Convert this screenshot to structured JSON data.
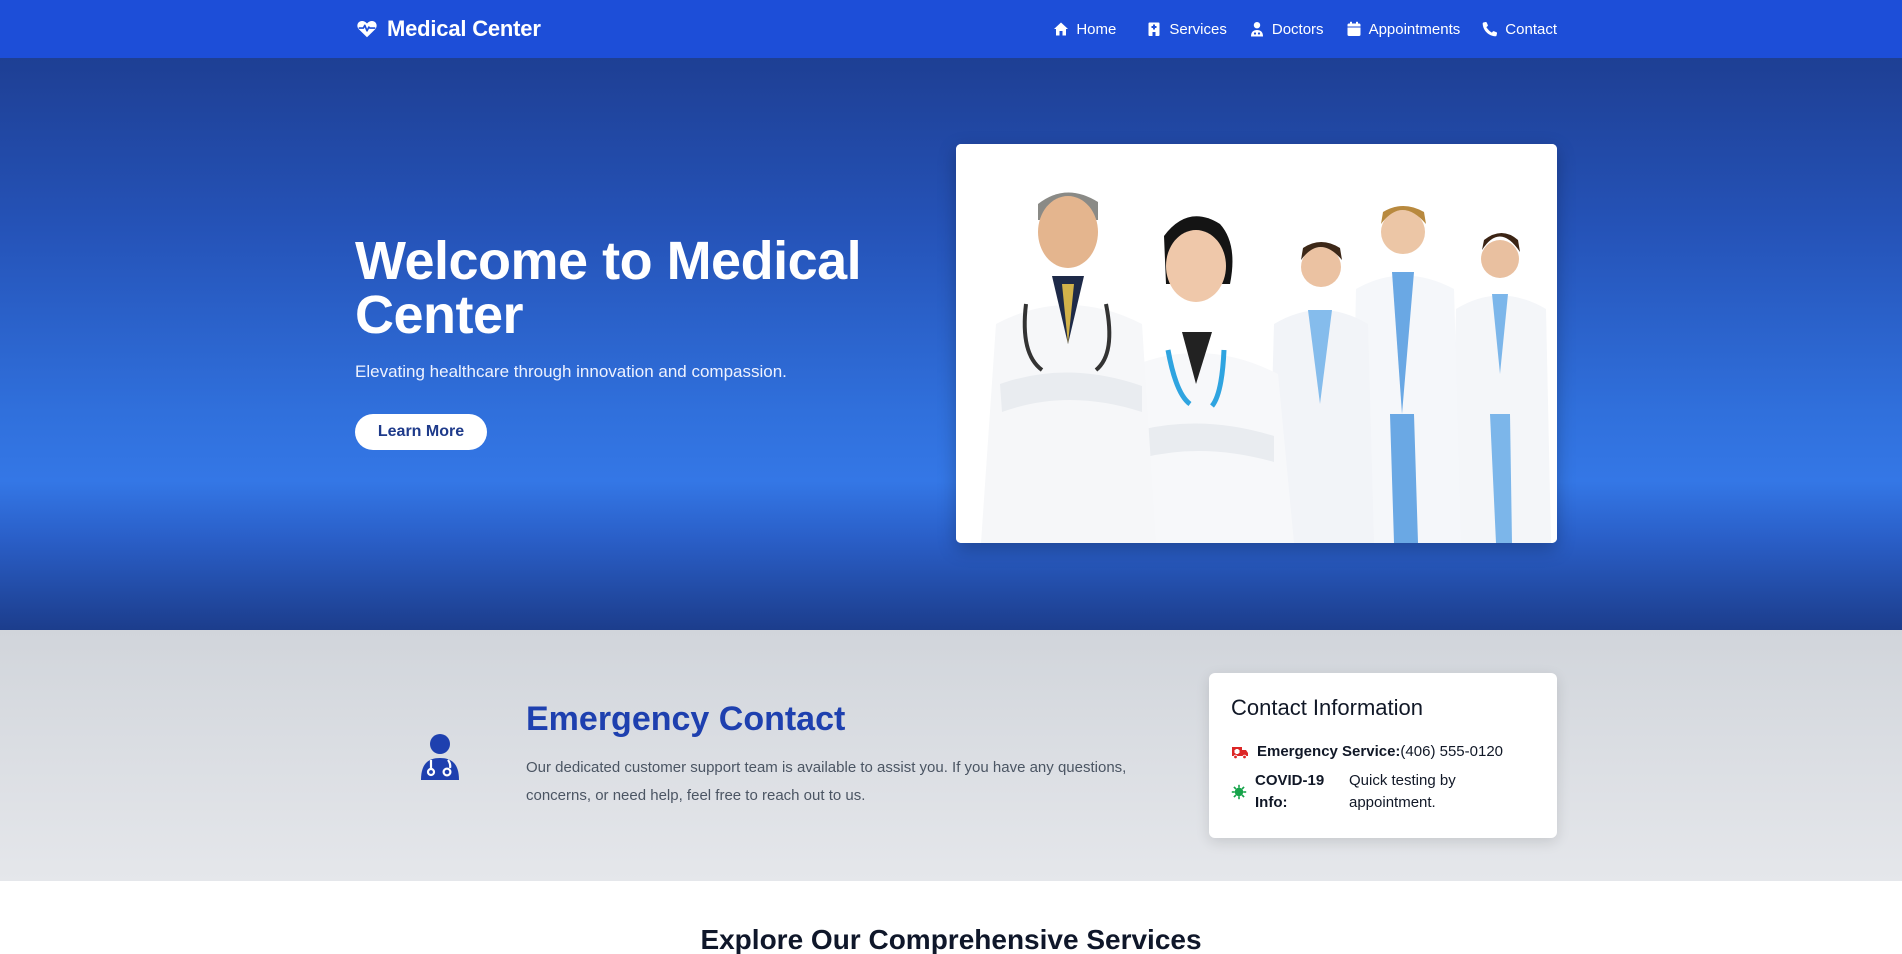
{
  "nav": {
    "brand": "Medical Center",
    "links": [
      {
        "label": "Home",
        "icon": "home-icon"
      },
      {
        "label": "Services",
        "icon": "hospital-icon"
      },
      {
        "label": "Doctors",
        "icon": "doctor-icon"
      },
      {
        "label": "Appointments",
        "icon": "calendar-icon"
      },
      {
        "label": "Contact",
        "icon": "phone-icon"
      }
    ]
  },
  "hero": {
    "title": "Welcome to Medical Center",
    "subtitle": "Elevating healthcare through innovation and compassion.",
    "button": "Learn More",
    "image": "team-of-doctors-photo"
  },
  "emergency": {
    "title": "Emergency Contact",
    "description": "Our dedicated customer support team is available to assist you. If you have any questions, concerns, or need help, feel free to reach out to us."
  },
  "contact_card": {
    "title": "Contact Information",
    "emergency_label": "Emergency Service:",
    "emergency_value": "(406) 555-0120",
    "covid_label": "COVID-19 Info:",
    "covid_value": "Quick testing by appointment."
  },
  "services": {
    "title": "Explore Our Comprehensive Services"
  },
  "colors": {
    "primary": "#1d4ed8",
    "heading_blue": "#1e40af",
    "ambulance": "#dc2626",
    "virus": "#16a34a"
  }
}
